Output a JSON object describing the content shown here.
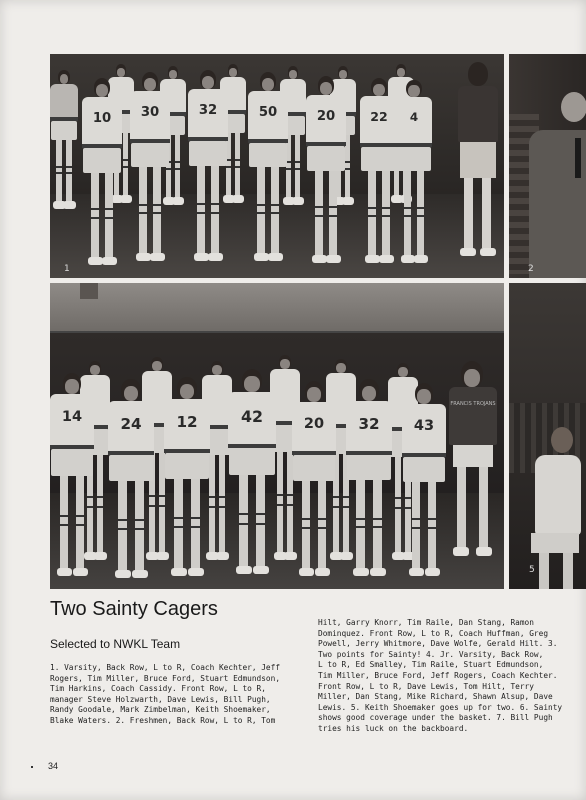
{
  "photos": [
    {
      "id": "photo-1",
      "number": "1",
      "jerseys": [
        "10",
        "30",
        "32",
        "50",
        "20",
        "22",
        "4"
      ]
    },
    {
      "id": "photo-2",
      "number": "2"
    },
    {
      "id": "photo-3",
      "number": "",
      "jerseys": [
        "14",
        "24",
        "12",
        "42",
        "20",
        "32",
        "43"
      ],
      "shirt_text": "FRANCIS TROJANS"
    },
    {
      "id": "photo-5",
      "number": "5"
    }
  ],
  "headline": "Two Sainty Cagers",
  "subhead": "Selected to NWKL Team",
  "caption_left": [
    "1. Varsity, Back Row, L to R, Coach Kechter, Jeff",
    "Rogers, Tim Miller, Bruce Ford, Stuart Edmundson,",
    "Tim Harkins, Coach Cassidy. Front Row, L to R,",
    "manager Steve Holzwarth, Dave Lewis, Bill Pugh,",
    "Randy Goodale, Mark Zimbelman, Keith Shoemaker,",
    "Blake Waters. 2. Freshmen, Back Row, L to R, Tom"
  ],
  "caption_right": [
    "Hilt, Garry Knorr, Tim Raile, Dan Stang, Ramon",
    "Dominquez. Front Row, L to R, Coach Huffman, Greg",
    "Powell, Jerry Whitmore, Dave Wolfe, Gerald Hilt. 3.",
    "Two points for Sainty! 4. Jr. Varsity, Back Row,",
    "L to R, Ed Smalley, Tim Raile, Stuart Edmundson,",
    "Tim Miller, Bruce Ford, Jeff Rogers, Coach Kechter.",
    "Front Row, L to R, Dave Lewis, Tom Hilt, Terry",
    "Miller, Dan Stang, Mike Richard, Shawn Alsup, Dave",
    "Lewis. 5. Keith Shoemaker goes up for two. 6. Sainty",
    "shows good coverage under the basket. 7. Bill Pugh",
    "tries his luck on the backboard."
  ],
  "page_number": "34"
}
